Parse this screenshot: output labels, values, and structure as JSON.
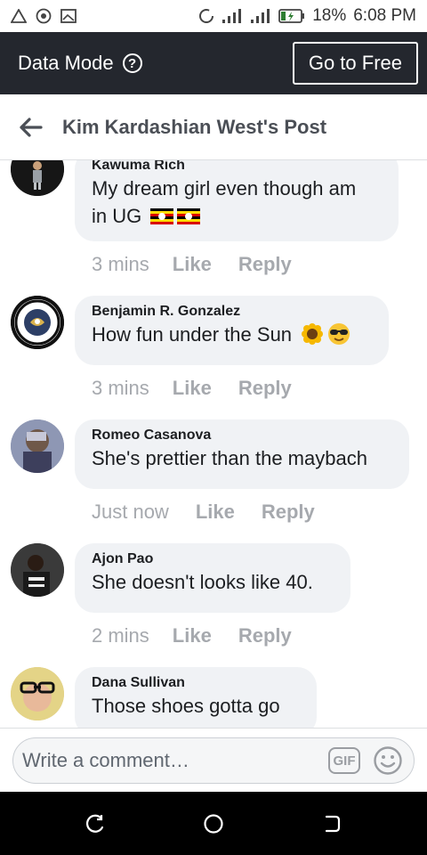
{
  "status_bar": {
    "battery": "18%",
    "time": "6:08 PM",
    "icons": [
      "warning-icon",
      "chrome-icon",
      "gallery-icon",
      "data-saver-icon",
      "signal-icon",
      "signal-4g-icon",
      "battery-charging-icon"
    ]
  },
  "data_bar": {
    "title": "Data Mode",
    "help_icon": "?",
    "button": "Go to Free"
  },
  "header": {
    "title": "Kim Kardashian West's Post",
    "back_icon": "arrow-left-icon"
  },
  "comments": [
    {
      "name": "Kawuma Rich",
      "text_line1": "My dream girl even though am",
      "text_line2": "in UG",
      "emoji": [
        "uganda-flag",
        "uganda-flag"
      ],
      "time": "3 mins",
      "like": "Like",
      "reply": "Reply"
    },
    {
      "name": "Benjamin R. Gonzalez",
      "text": "How fun under the Sun",
      "emoji": [
        "sunflower",
        "sunglasses-face"
      ],
      "time": "3 mins",
      "like": "Like",
      "reply": "Reply"
    },
    {
      "name": "Romeo Casanova",
      "text": "She's prettier than the maybach",
      "time": "Just now",
      "like": "Like",
      "reply": "Reply"
    },
    {
      "name": "Ajon Pao",
      "text": "She doesn't looks like 40.",
      "time": "2 mins",
      "like": "Like",
      "reply": "Reply"
    },
    {
      "name": "Dana Sullivan",
      "text": "Those shoes gotta go"
    }
  ],
  "composer": {
    "placeholder": "Write a comment…",
    "gif_label": "GIF"
  },
  "colors": {
    "data_bar_bg": "#24272e",
    "bubble_bg": "#f0f2f5",
    "meta_text": "#a6a9ae"
  }
}
